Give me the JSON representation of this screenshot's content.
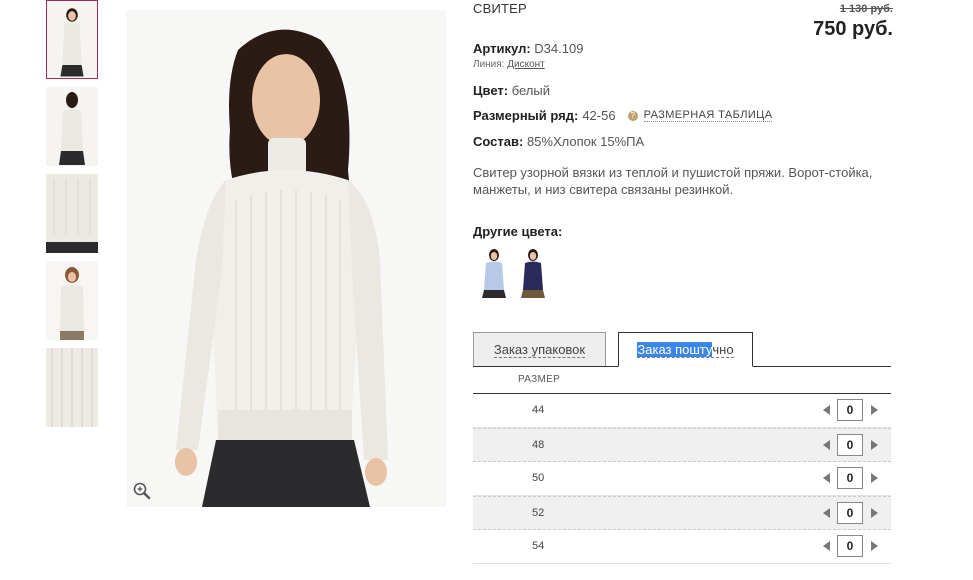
{
  "product": {
    "title": "СВИТЕР",
    "old_price": "1 130 руб.",
    "price": "750 руб.",
    "article_label": "Артикул:",
    "article_value": "D34.109",
    "line_label": "Линия:",
    "line_value": "Дисконт",
    "color_label": "Цвет:",
    "color_value": "белый",
    "size_range_label": "Размерный ряд:",
    "size_range_value": "42-56",
    "size_table_link": "РАЗМЕРНАЯ ТАБЛИЦА",
    "composition_label": "Состав:",
    "composition_value": "85%Хлопок 15%ПА",
    "description": "Свитер узорной вязки из теплой и пушистой пряжи. Ворот-стойка, манжеты, и низ свитера связаны резинкой.",
    "other_colors_label": "Другие цвета:",
    "other_colors": [
      {
        "name": "light-blue",
        "color": "#b7c9e6"
      },
      {
        "name": "navy",
        "color": "#2a2a5a"
      }
    ]
  },
  "thumbnails": [
    {
      "name": "front"
    },
    {
      "name": "back"
    },
    {
      "name": "detail"
    },
    {
      "name": "model-2"
    },
    {
      "name": "texture"
    }
  ],
  "tabs": {
    "pack_order": "Заказ упаковок",
    "piece_order_selected": "Заказ пошту",
    "piece_order_rest": "чно"
  },
  "sizes": {
    "header": "РАЗМЕР",
    "rows": [
      {
        "size": "44",
        "qty": "0"
      },
      {
        "size": "48",
        "qty": "0"
      },
      {
        "size": "50",
        "qty": "0"
      },
      {
        "size": "52",
        "qty": "0"
      },
      {
        "size": "54",
        "qty": "0"
      }
    ]
  },
  "colors": {
    "accent": "#a0285a",
    "selection": "#3a86e8",
    "sweater": "#f1efea",
    "skirt": "#2b2b2e",
    "hair": "#2a1b14",
    "skin": "#e9c3a6"
  }
}
